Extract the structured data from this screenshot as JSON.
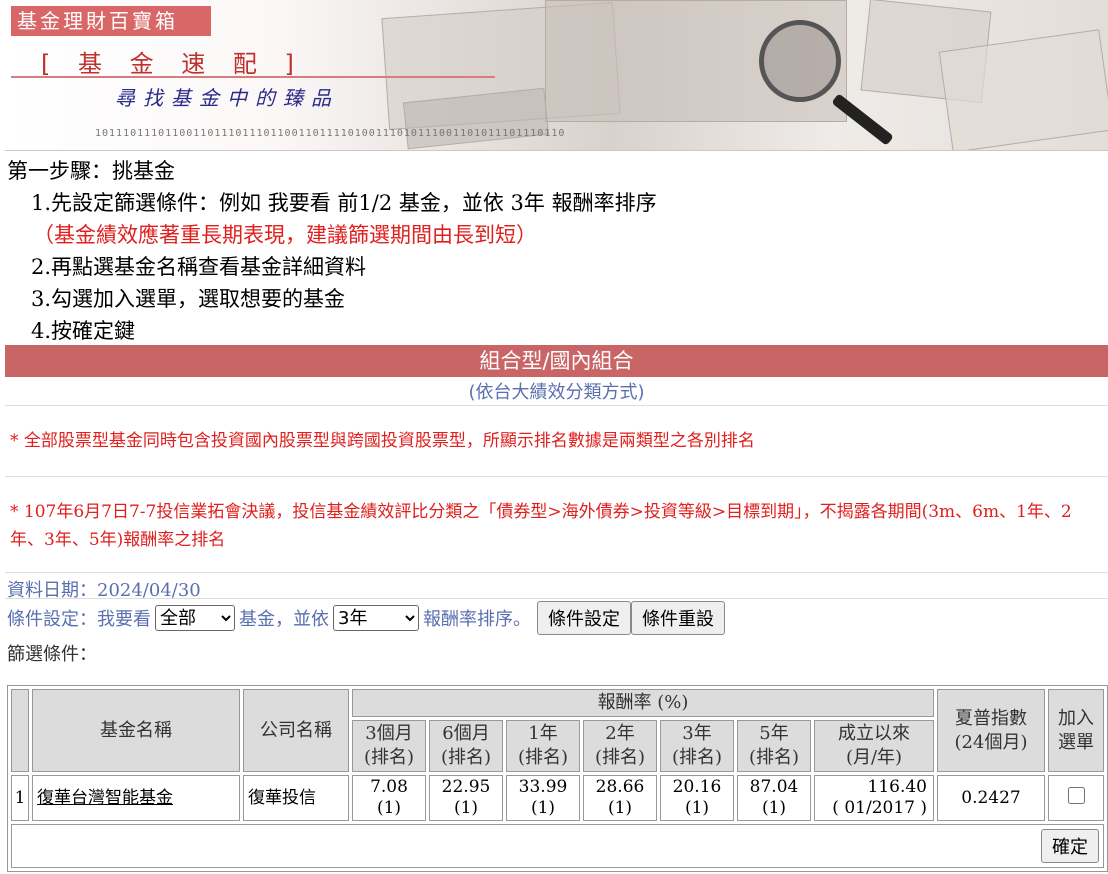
{
  "banner": {
    "brand": "基金理財百寶箱",
    "title": "[ 基 金 速 配 ]",
    "subtitle": "尋找基金中的臻品",
    "digit_strip": "1011101110110011011101110110011011110100111010111001101011101110110"
  },
  "steps": {
    "heading": "第一步驟：挑基金",
    "items": [
      "1.先設定篩選條件：例如 我要看 前1/2 基金，並依 3年 報酬率排序",
      "2.再點選基金名稱查看基金詳細資料",
      "3.勾選加入選單，選取想要的基金",
      "4.按確定鍵"
    ],
    "warning": "（基金績效應著重長期表現，建議篩選期間由長到短）"
  },
  "category": {
    "title": "組合型/國內組合",
    "subtitle": "(依台大績效分類方式)"
  },
  "notes": [
    "* 全部股票型基金同時包含投資國內股票型與跨國投資股票型，所顯示排名數據是兩類型之各別排名",
    "* 107年6月7日7-7投信業拓會決議，投信基金績效評比分類之「債券型>海外債券>投資等級>目標到期」，不揭露各期間(3m、6m、1年、2年、3年、5年)報酬率之排名"
  ],
  "data_date": "資料日期：2024/04/30",
  "conditions": {
    "label": "條件設定：我要看",
    "scope_value": "全部",
    "mid": "基金，並依",
    "period_value": "3年",
    "tail": "報酬率排序。",
    "set_button": "條件設定",
    "reset_button": "條件重設"
  },
  "filter_label": "篩選條件：",
  "table": {
    "headers": {
      "name": "基金名稱",
      "company": "公司名稱",
      "return_group": "報酬率 (%)",
      "periods": [
        [
          "3個月",
          "(排名)"
        ],
        [
          "6個月",
          "(排名)"
        ],
        [
          "1年",
          "(排名)"
        ],
        [
          "2年",
          "(排名)"
        ],
        [
          "3年",
          "(排名)"
        ],
        [
          "5年",
          "(排名)"
        ],
        [
          "成立以來",
          "(月/年)"
        ]
      ],
      "sharpe": [
        "夏普指數",
        "(24個月)"
      ],
      "add": [
        "加入",
        "選單"
      ]
    },
    "rows": [
      {
        "index": "1",
        "name": "復華台灣智能基金",
        "company": "復華投信",
        "returns": [
          [
            "7.08",
            "(1)"
          ],
          [
            "22.95",
            "(1)"
          ],
          [
            "33.99",
            "(1)"
          ],
          [
            "28.66",
            "(1)"
          ],
          [
            "20.16",
            "(1)"
          ],
          [
            "87.04",
            "(1)"
          ],
          [
            "116.40",
            "( 01/2017 )"
          ]
        ],
        "sharpe": "0.2427",
        "checked": false
      }
    ],
    "confirm_button": "確定"
  }
}
